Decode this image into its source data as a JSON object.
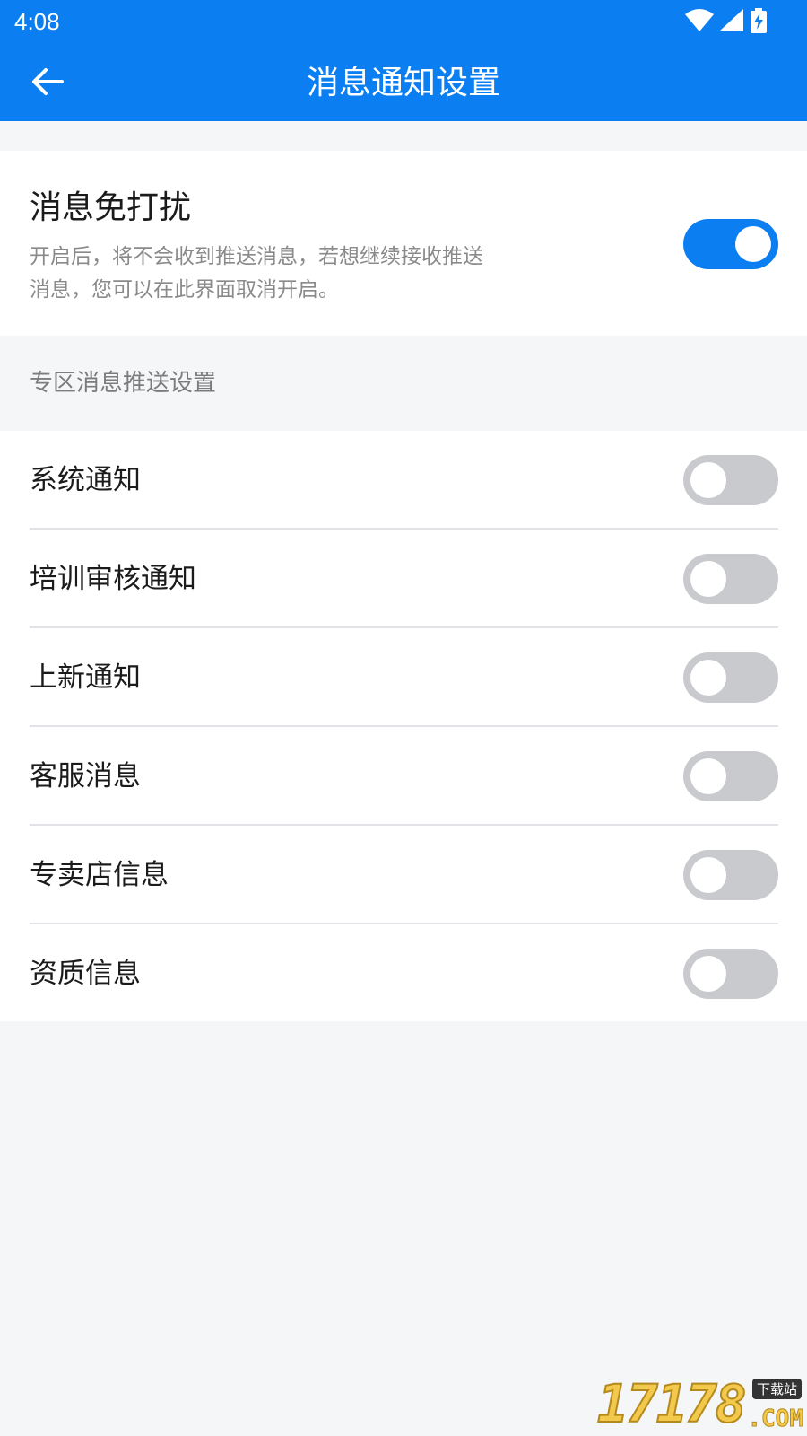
{
  "status_bar": {
    "time": "4:08",
    "icons": [
      "wifi-icon",
      "cellular-signal-icon",
      "battery-charging-icon"
    ]
  },
  "header": {
    "title": "消息通知设置",
    "back_icon": "arrow-left-icon",
    "background_color": "#0b7ff2"
  },
  "do_not_disturb": {
    "title": "消息免打扰",
    "description": "开启后，将不会收到推送消息，若想继续接收推送消息，您可以在此界面取消开启。",
    "enabled": true
  },
  "section": {
    "label": "专区消息推送设置"
  },
  "settings": [
    {
      "label": "系统通知",
      "enabled": false
    },
    {
      "label": "培训审核通知",
      "enabled": false
    },
    {
      "label": "上新通知",
      "enabled": false
    },
    {
      "label": "客服消息",
      "enabled": false
    },
    {
      "label": "专卖店信息",
      "enabled": false
    },
    {
      "label": "资质信息",
      "enabled": false
    }
  ],
  "colors": {
    "switch_on": "#0b7ff2",
    "switch_off": "#c9cacd"
  },
  "watermark": {
    "digits": "17178",
    "tag": "下载站",
    "suffix": ".COM"
  }
}
